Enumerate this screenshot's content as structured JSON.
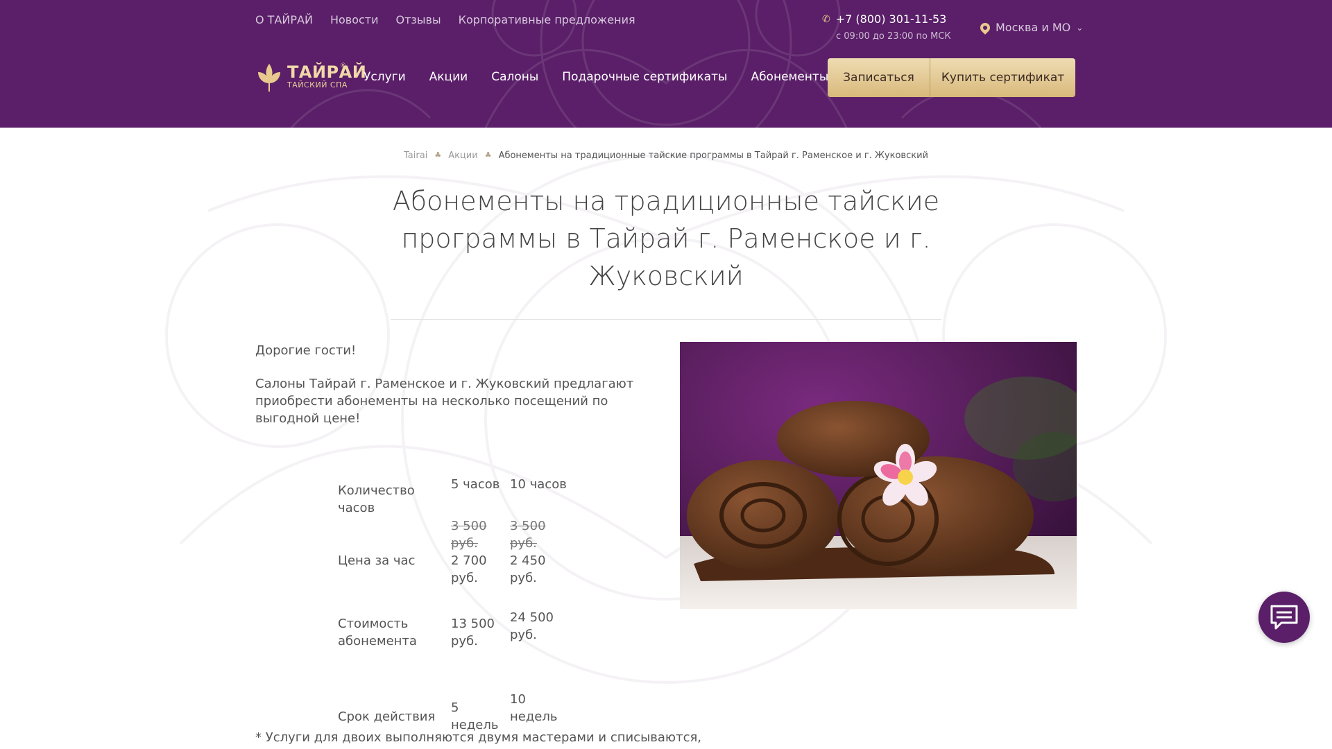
{
  "header": {
    "top_links": [
      "О ТАЙРАЙ",
      "Новости",
      "Отзывы",
      "Корпоративные предложения"
    ],
    "phone": "+7 (800) 301-11-53",
    "hours": "с 09:00 до 23:00 по МСК",
    "region": "Москва и МО",
    "logo_title": "ТАЙРАЙ",
    "logo_sub": "ТАЙСКИЙ СПА",
    "logo_reg": "®",
    "nav": [
      "Услуги",
      "Акции",
      "Салоны",
      "Подарочные сертификаты",
      "Абонементы"
    ],
    "book_label": "Записаться",
    "cert_label": "Купить сертификат"
  },
  "breadcrumb": {
    "items": [
      "Tairai",
      "Акции"
    ],
    "current": "Абонементы на традиционные тайские программы в Тайрай г. Раменское и г. Жуковский"
  },
  "title": "Абонементы на традиционные тайские программы в Тайрай г. Раменское и г. Жуковский",
  "intro": {
    "greeting": "Дорогие гости!",
    "text": "Салоны Тайрай г. Раменское и г. Жуковский  предлагают приобрести абонементы на несколько посещений по выгодной цене!"
  },
  "table": {
    "rows": [
      {
        "label": "Количество часов",
        "a": "5 часов",
        "b": "10 часов"
      },
      {
        "label": "Цена за час",
        "a_old": "3 500 руб.",
        "a": "2 700 руб.",
        "b_old": "3 500 руб.",
        "b": "2 450 руб."
      },
      {
        "label": "Стоимость абонемента",
        "a": "13 500 руб.",
        "b": "24 500 руб."
      },
      {
        "label": "Срок действия",
        "a": "5 недель",
        "b": "10 недель"
      }
    ]
  },
  "footnote": "* Услуги для двоих выполняются двумя мастерами и списываются,",
  "colors": {
    "header_bg": "#5a1f68",
    "gold": "#e8c98e",
    "button": "#dfc58f"
  }
}
